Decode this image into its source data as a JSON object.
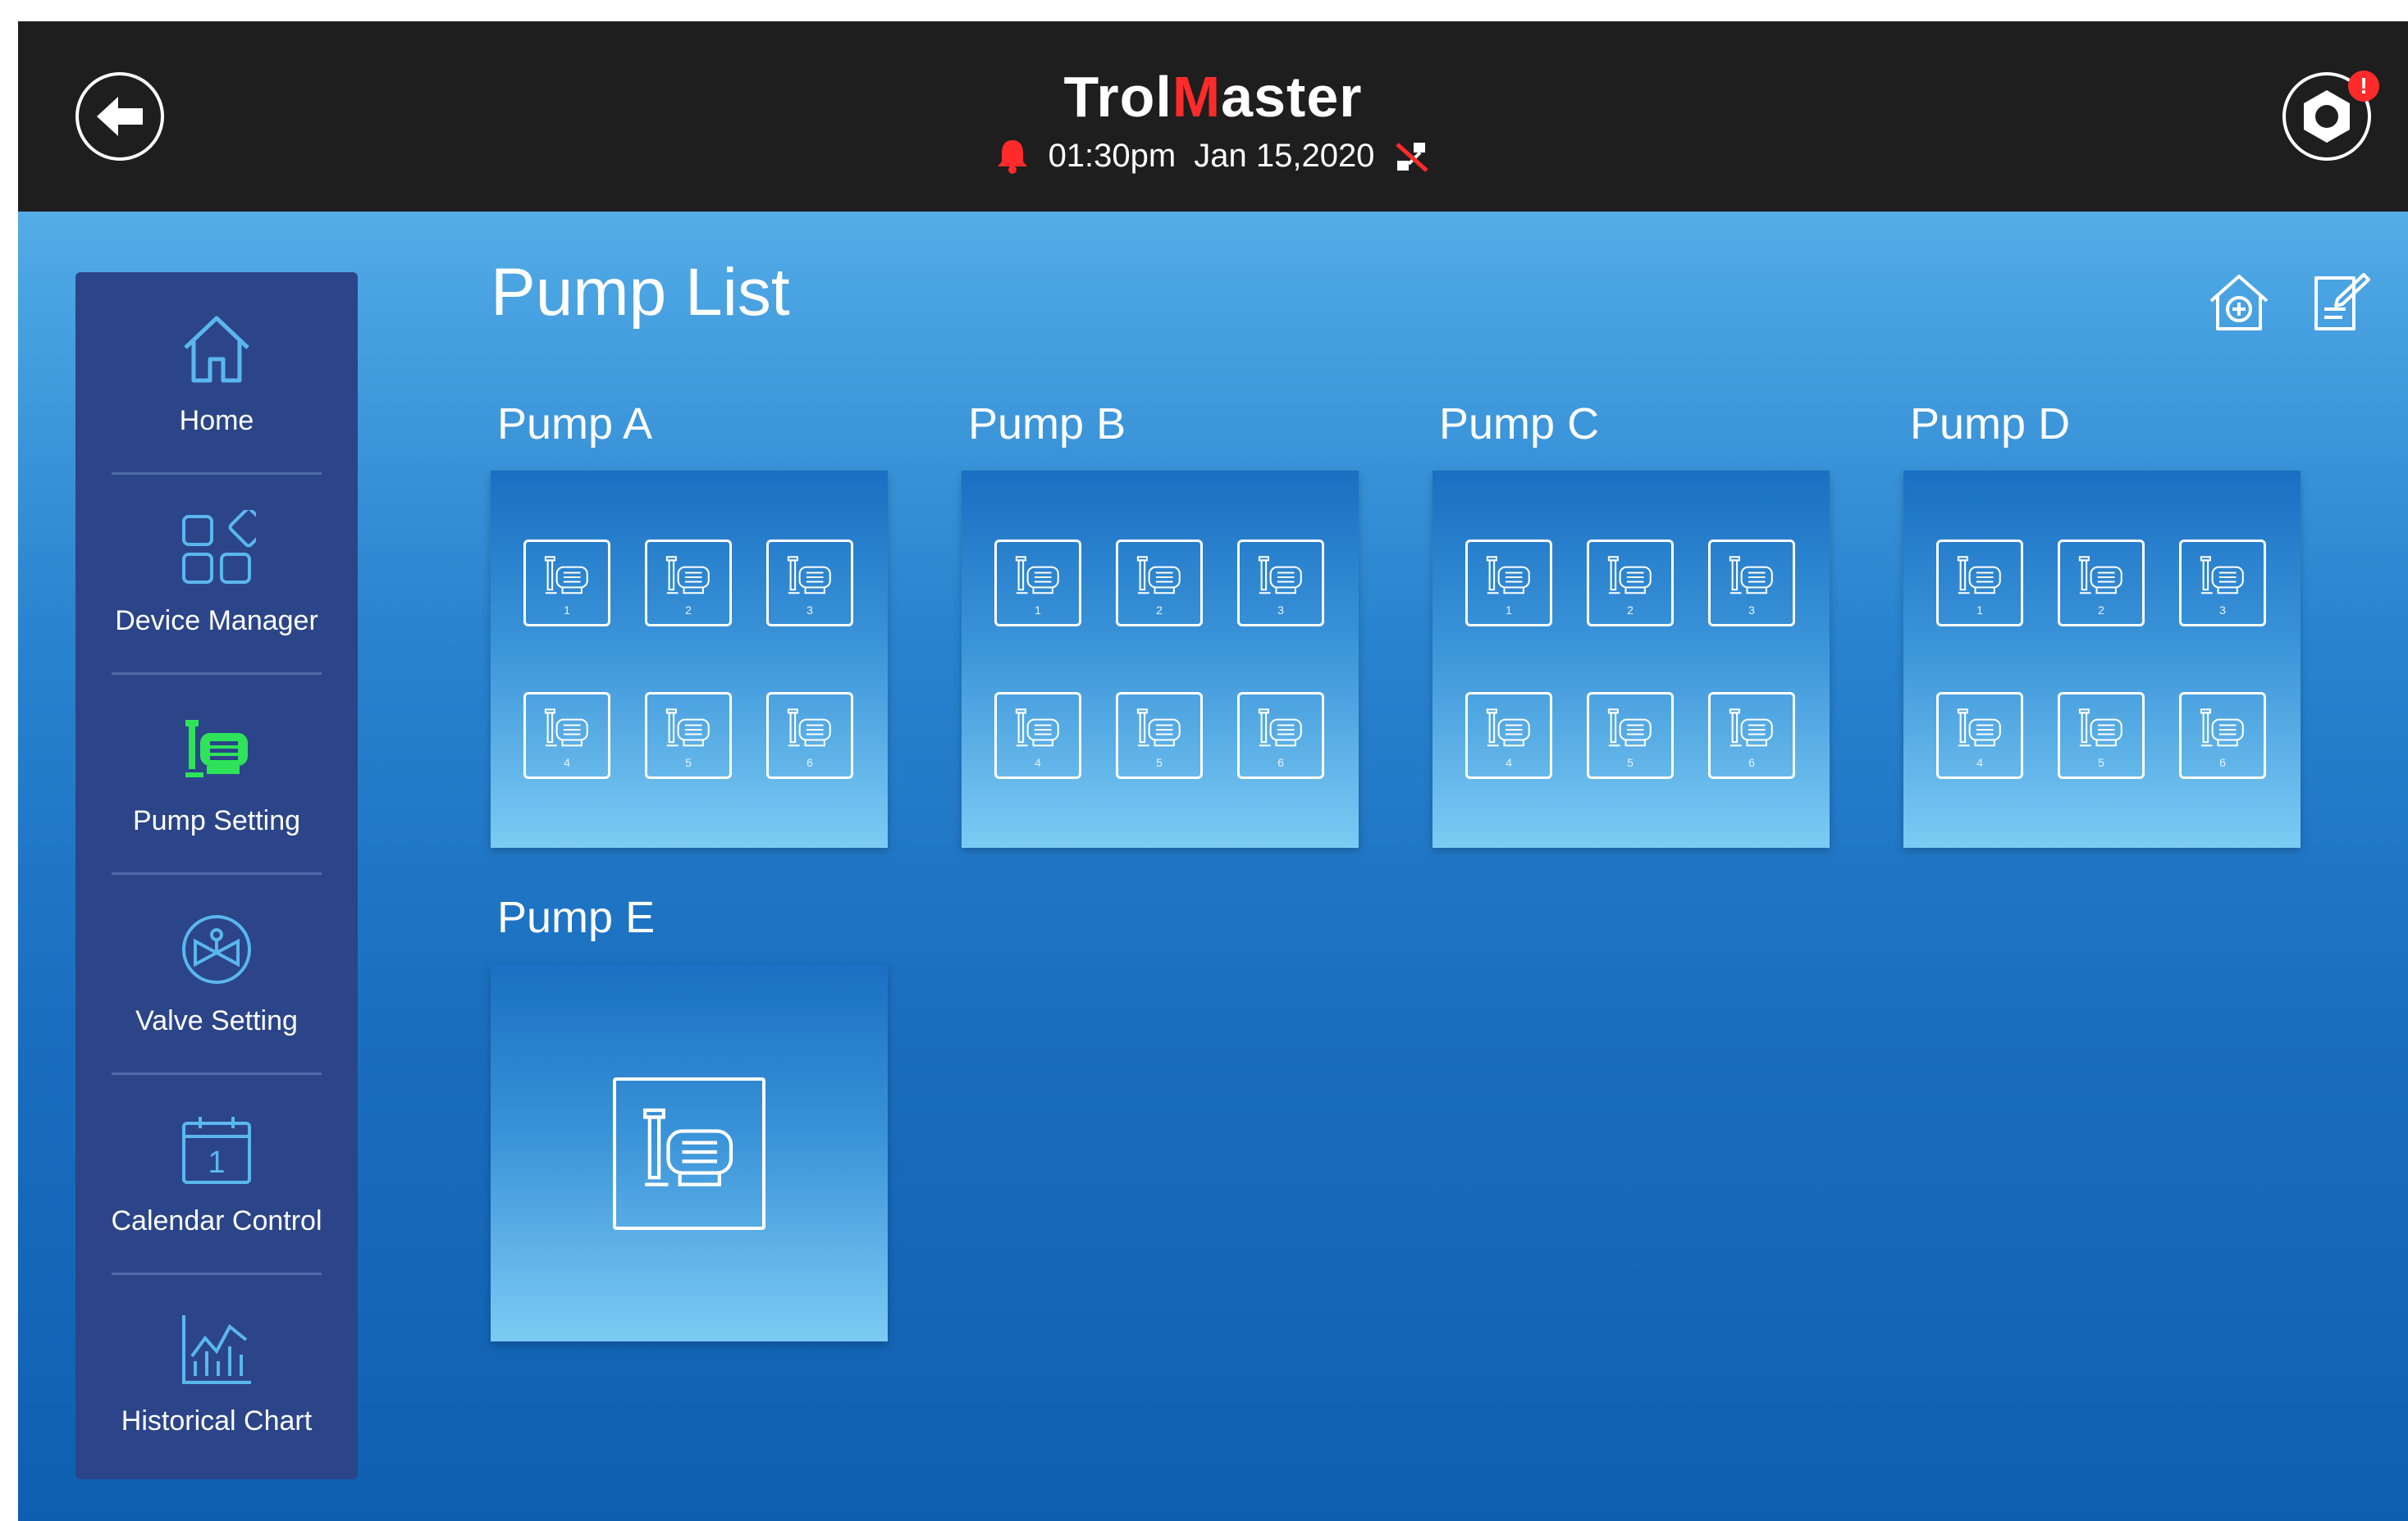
{
  "header": {
    "brand_prefix": "Trol",
    "brand_accent": "M",
    "brand_suffix": "aster",
    "time": "01:30pm",
    "date": "Jan 15,2020",
    "notification_badge": "!",
    "alert_color": "#ff2b2b"
  },
  "sidebar": {
    "items": [
      {
        "label": "Home",
        "icon": "home-icon",
        "active": false
      },
      {
        "label": "Device Manager",
        "icon": "device-grid-icon",
        "active": false
      },
      {
        "label": "Pump Setting",
        "icon": "pump-icon",
        "active": true
      },
      {
        "label": "Valve Setting",
        "icon": "valve-icon",
        "active": false
      },
      {
        "label": "Calendar Control",
        "icon": "calendar-icon",
        "calendar_day": "1",
        "active": false
      },
      {
        "label": "Historical Chart",
        "icon": "chart-icon",
        "active": false
      }
    ],
    "active_color": "#2ee35a"
  },
  "main": {
    "title": "Pump List",
    "actions": [
      {
        "icon": "home-add-icon"
      },
      {
        "icon": "edit-note-icon"
      }
    ],
    "pumps": [
      {
        "name": "Pump A",
        "outlets": [
          "1",
          "2",
          "3",
          "4",
          "5",
          "6"
        ]
      },
      {
        "name": "Pump B",
        "outlets": [
          "1",
          "2",
          "3",
          "4",
          "5",
          "6"
        ]
      },
      {
        "name": "Pump C",
        "outlets": [
          "1",
          "2",
          "3",
          "4",
          "5",
          "6"
        ]
      },
      {
        "name": "Pump D",
        "outlets": [
          "1",
          "2",
          "3",
          "4",
          "5",
          "6"
        ]
      },
      {
        "name": "Pump E",
        "outlets": []
      }
    ]
  }
}
